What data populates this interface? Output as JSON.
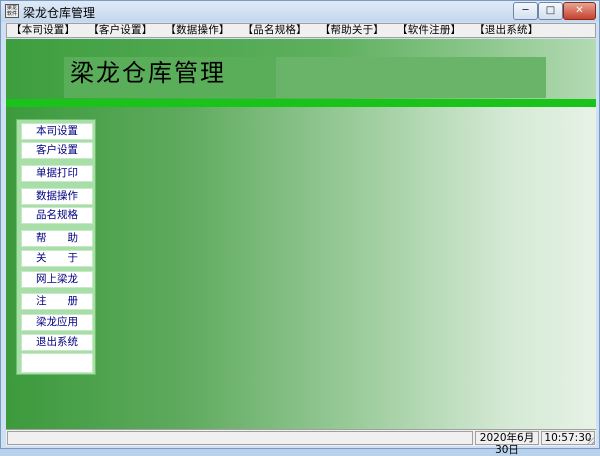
{
  "window": {
    "title": "梁龙仓库管理",
    "icon_text": "梁龙软件",
    "controls": {
      "minimize": "─",
      "maximize": "□",
      "close": "✕"
    }
  },
  "menu": [
    "【本司设置】",
    "【客户设置】",
    "【数据操作】",
    "【品名规格】",
    "【帮助关于】",
    "【软件注册】",
    "【退出系统】"
  ],
  "banner": {
    "title": "梁龙仓库管理"
  },
  "sidebar": [
    "本司设置",
    "客户设置",
    "单据打印",
    "数据操作",
    "品名规格",
    "帮　　助",
    "关　　于",
    "网上梁龙",
    "注　　册",
    "梁龙应用",
    "退出系统"
  ],
  "status": {
    "message": "",
    "date": "2020年6月30日",
    "time": "10:57:30"
  },
  "colors": {
    "banner_green": "#3e9e3e",
    "bar_green": "#1ac31a",
    "panel_green": "#a8dfa8",
    "link_blue": "#000080"
  }
}
